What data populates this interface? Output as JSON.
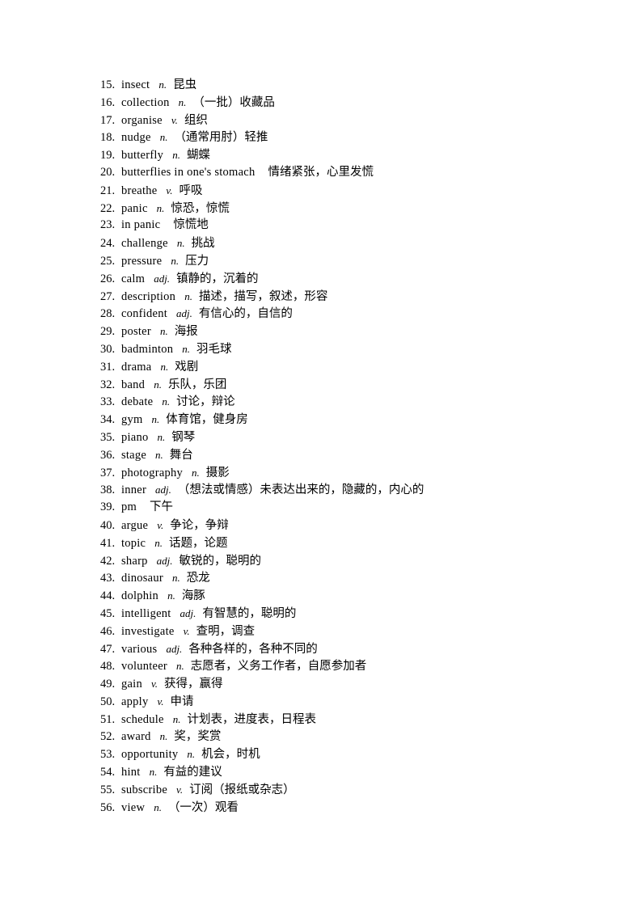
{
  "document": {
    "type": "vocabulary-list",
    "language_pair": "English-Chinese",
    "page_background": "#ffffff",
    "text_color": "#000000",
    "entries": [
      {
        "num": "15.",
        "word": "insect",
        "pos": "n.",
        "definition": "昆虫"
      },
      {
        "num": "16.",
        "word": "collection",
        "pos": "n.",
        "definition": "（一批）收藏品"
      },
      {
        "num": "17.",
        "word": "organise",
        "pos": "v.",
        "definition": "组织"
      },
      {
        "num": "18.",
        "word": "nudge",
        "pos": "n.",
        "definition": "（通常用肘）轻推"
      },
      {
        "num": "19.",
        "word": "butterfly",
        "pos": "n.",
        "definition": "蝴蝶"
      },
      {
        "num": "20.",
        "word": "butterflies in one's stomach",
        "pos": "",
        "definition": "情绪紧张，心里发慌"
      },
      {
        "num": "21.",
        "word": "breathe",
        "pos": "v.",
        "definition": "呼吸"
      },
      {
        "num": "22.",
        "word": "panic",
        "pos": "n.",
        "definition": "惊恐，惊慌"
      },
      {
        "num": "23.",
        "word": "in panic",
        "pos": "",
        "definition": "惊慌地"
      },
      {
        "num": "24.",
        "word": "challenge",
        "pos": "n.",
        "definition": "挑战"
      },
      {
        "num": "25.",
        "word": "pressure",
        "pos": "n.",
        "definition": "压力"
      },
      {
        "num": "26.",
        "word": "calm",
        "pos": "adj.",
        "definition": "镇静的，沉着的"
      },
      {
        "num": "27.",
        "word": "description",
        "pos": "n.",
        "definition": "描述，描写，叙述，形容"
      },
      {
        "num": "28.",
        "word": "confident",
        "pos": "adj.",
        "definition": "有信心的，自信的"
      },
      {
        "num": "29.",
        "word": "poster",
        "pos": "n.",
        "definition": "海报"
      },
      {
        "num": "30.",
        "word": "badminton",
        "pos": "n.",
        "definition": "羽毛球"
      },
      {
        "num": "31.",
        "word": "drama",
        "pos": "n.",
        "definition": "戏剧"
      },
      {
        "num": "32.",
        "word": "band",
        "pos": "n.",
        "definition": "乐队，乐团"
      },
      {
        "num": "33.",
        "word": "debate",
        "pos": "n.",
        "definition": "讨论，辩论"
      },
      {
        "num": "34.",
        "word": "gym",
        "pos": "n.",
        "definition": "体育馆，健身房"
      },
      {
        "num": "35.",
        "word": "piano",
        "pos": "n.",
        "definition": "钢琴"
      },
      {
        "num": "36.",
        "word": "stage",
        "pos": "n.",
        "definition": "舞台"
      },
      {
        "num": "37.",
        "word": "photography",
        "pos": "n.",
        "definition": "摄影"
      },
      {
        "num": "38.",
        "word": "inner",
        "pos": "adj.",
        "definition": "（想法或情感）未表达出来的，隐藏的，内心的"
      },
      {
        "num": "39.",
        "word": "pm",
        "pos": "",
        "definition": "下午"
      },
      {
        "num": "40.",
        "word": "argue",
        "pos": "v.",
        "definition": "争论，争辩"
      },
      {
        "num": "41.",
        "word": "topic",
        "pos": "n.",
        "definition": "话题，论题"
      },
      {
        "num": "42.",
        "word": "sharp",
        "pos": "adj.",
        "definition": "敏锐的，聪明的"
      },
      {
        "num": "43.",
        "word": "dinosaur",
        "pos": "n.",
        "definition": "恐龙"
      },
      {
        "num": "44.",
        "word": "dolphin",
        "pos": "n.",
        "definition": "海豚"
      },
      {
        "num": "45.",
        "word": "intelligent",
        "pos": "adj.",
        "definition": "有智慧的，聪明的"
      },
      {
        "num": "46.",
        "word": "investigate",
        "pos": "v.",
        "definition": "查明，调查"
      },
      {
        "num": "47.",
        "word": "various",
        "pos": "adj.",
        "definition": "各种各样的，各种不同的"
      },
      {
        "num": "48.",
        "word": "volunteer",
        "pos": "n.",
        "definition": "志愿者，义务工作者，自愿参加者"
      },
      {
        "num": "49.",
        "word": "gain",
        "pos": "v.",
        "definition": "获得，赢得"
      },
      {
        "num": "50.",
        "word": "apply",
        "pos": "v.",
        "definition": "申请"
      },
      {
        "num": "51.",
        "word": "schedule",
        "pos": "n.",
        "definition": "计划表，进度表，日程表"
      },
      {
        "num": "52.",
        "word": "award",
        "pos": "n.",
        "definition": "奖，奖赏"
      },
      {
        "num": "53.",
        "word": "opportunity",
        "pos": "n.",
        "definition": "机会，时机"
      },
      {
        "num": "54.",
        "word": "hint",
        "pos": "n.",
        "definition": "有益的建议"
      },
      {
        "num": "55.",
        "word": "subscribe",
        "pos": "v.",
        "definition": "订阅（报纸或杂志）"
      },
      {
        "num": "56.",
        "word": "view",
        "pos": "n.",
        "definition": "（一次）观看"
      }
    ]
  }
}
